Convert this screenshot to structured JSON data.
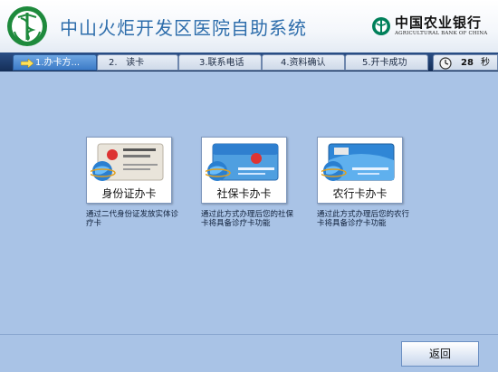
{
  "header": {
    "title": "中山火炬开发区医院自助系统",
    "bank_name": "中国农业银行",
    "bank_english": "AGRICULTURAL BANK OF CHINA"
  },
  "steps": [
    {
      "label": "1.办卡方...",
      "active": true
    },
    {
      "label": "2.   读卡",
      "active": false
    },
    {
      "label": "3.联系电话",
      "active": false
    },
    {
      "label": "4.资料确认",
      "active": false
    },
    {
      "label": "5.开卡成功",
      "active": false
    }
  ],
  "timer": {
    "seconds": "28",
    "unit": "秒"
  },
  "options": [
    {
      "label": "身份证办卡",
      "description": "通过二代身份证发放实体诊疗卡",
      "icon": "id-card-icon"
    },
    {
      "label": "社保卡办卡",
      "description": "通过此方式办理后您的社保卡将具备诊疗卡功能",
      "icon": "social-security-card-icon"
    },
    {
      "label": "农行卡办卡",
      "description": "通过此方式办理后您的农行卡将具备诊疗卡功能",
      "icon": "bank-card-icon"
    }
  ],
  "footer": {
    "back_label": "返回"
  },
  "colors": {
    "background": "#a9c3e6",
    "title": "#2d6dab",
    "stepbar": "#1d3a6a",
    "active_step": "#3c7bc7",
    "hospital_logo": "#1e8a3c"
  }
}
